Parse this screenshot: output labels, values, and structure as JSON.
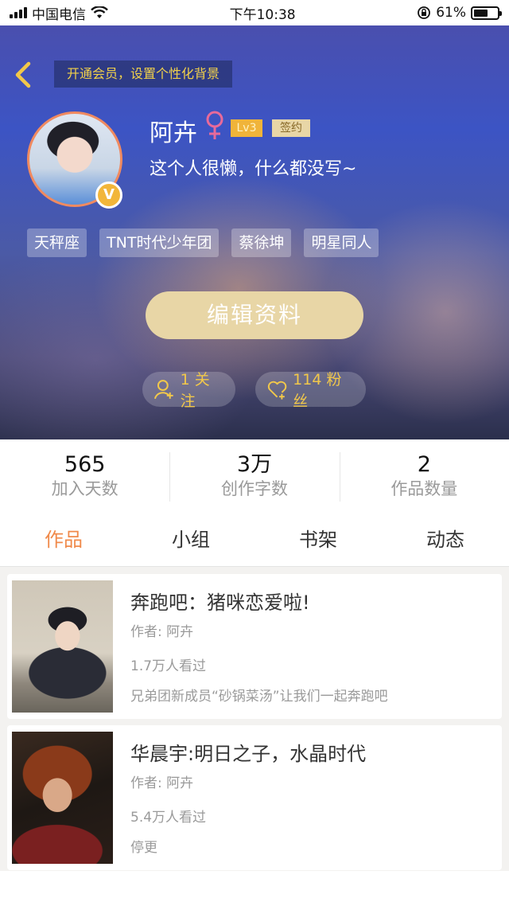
{
  "status_bar": {
    "carrier": "中国电信",
    "time": "下午10:38",
    "battery_percent": "61%",
    "battery_level": 0.61
  },
  "header": {
    "vip_banner": "开通会员，设置个性化背景",
    "user_name": "阿卉",
    "level": "Lv3",
    "sign_badge": "签约",
    "bio": "这个人很懒，什么都没写~",
    "tags": [
      "天秤座",
      "TNT时代少年团",
      "蔡徐坤",
      "明星同人"
    ],
    "edit_button": "编辑资料",
    "follow_label": "1 关注",
    "fans_label": "114 粉丝"
  },
  "stats": [
    {
      "value": "565",
      "label": "加入天数"
    },
    {
      "value": "3万",
      "label": "创作字数"
    },
    {
      "value": "2",
      "label": "作品数量"
    }
  ],
  "tabs": [
    {
      "label": "作品",
      "active": true
    },
    {
      "label": "小组",
      "active": false
    },
    {
      "label": "书架",
      "active": false
    },
    {
      "label": "动态",
      "active": false
    }
  ],
  "works": [
    {
      "title": "奔跑吧：猪咪恋爱啦!",
      "author": "作者: 阿卉",
      "views": "1.7万人看过",
      "desc": "兄弟团新成员“砂锅菜汤”让我们一起奔跑吧"
    },
    {
      "title": "华晨宇:明日之子，水晶时代",
      "author": "作者: 阿卉",
      "views": "5.4万人看过",
      "desc": "停更"
    }
  ],
  "colors": {
    "accent": "#f08a4b",
    "gold": "#f2c84a",
    "button_bg": "#e8d6a6"
  }
}
